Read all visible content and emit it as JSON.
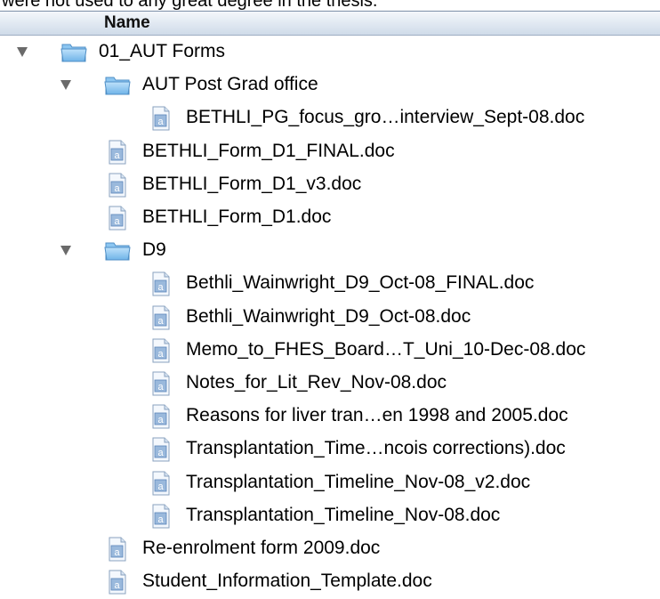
{
  "caption": "were not used to any great degree in the thesis.",
  "header": {
    "column_name": "Name"
  },
  "items": [
    {
      "type": "folder",
      "label": "01_AUT Forms",
      "expanded": true,
      "depth": 0
    },
    {
      "type": "folder",
      "label": "AUT Post Grad office",
      "expanded": true,
      "depth": 1
    },
    {
      "type": "file",
      "label": "BETHLI_PG_focus_gro…interview_Sept-08.doc",
      "depth": 2
    },
    {
      "type": "file",
      "label": "BETHLI_Form_D1_FINAL.doc",
      "depth": 1
    },
    {
      "type": "file",
      "label": "BETHLI_Form_D1_v3.doc",
      "depth": 1
    },
    {
      "type": "file",
      "label": "BETHLI_Form_D1.doc",
      "depth": 1
    },
    {
      "type": "folder",
      "label": "D9",
      "expanded": true,
      "depth": 1
    },
    {
      "type": "file",
      "label": "Bethli_Wainwright_D9_Oct-08_FINAL.doc",
      "depth": 2
    },
    {
      "type": "file",
      "label": "Bethli_Wainwright_D9_Oct-08.doc",
      "depth": 2
    },
    {
      "type": "file",
      "label": "Memo_to_FHES_Board…T_Uni_10-Dec-08.doc",
      "depth": 2
    },
    {
      "type": "file",
      "label": "Notes_for_Lit_Rev_Nov-08.doc",
      "depth": 2
    },
    {
      "type": "file",
      "label": "Reasons for liver tran…en 1998 and 2005.doc",
      "depth": 2
    },
    {
      "type": "file",
      "label": "Transplantation_Time…ncois corrections).doc",
      "depth": 2
    },
    {
      "type": "file",
      "label": "Transplantation_Timeline_Nov-08_v2.doc",
      "depth": 2
    },
    {
      "type": "file",
      "label": "Transplantation_Timeline_Nov-08.doc",
      "depth": 2
    },
    {
      "type": "file",
      "label": "Re-enrolment form 2009.doc",
      "depth": 1
    },
    {
      "type": "file",
      "label": "Student_Information_Template.doc",
      "depth": 1
    }
  ]
}
